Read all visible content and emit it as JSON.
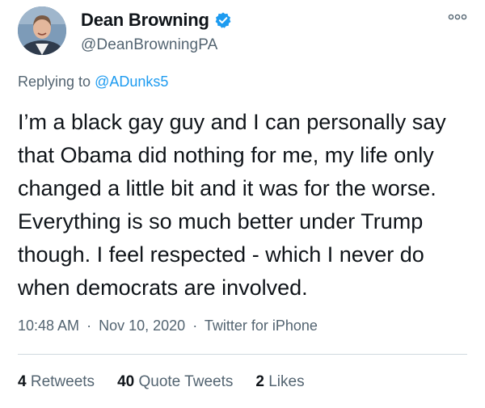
{
  "author": {
    "display_name": "Dean Browning",
    "handle": "@DeanBrowningPA",
    "verified": true
  },
  "more_icon": "more-horizontal-icon",
  "reply": {
    "prefix": "Replying to ",
    "mention": "@ADunks5"
  },
  "tweet": {
    "text": "I’m a black gay guy and I can personally say that Obama did nothing for me, my life only changed a little bit and it was for the worse. Everything is so much better under Trump though. I feel respected - which I never do when democrats are involved."
  },
  "meta": {
    "time": "10:48 AM",
    "separator": "·",
    "date": "Nov 10, 2020",
    "source": "Twitter for iPhone"
  },
  "stats": {
    "retweets_count": "4",
    "retweets_label": "Retweets",
    "quotes_count": "40",
    "quotes_label": "Quote Tweets",
    "likes_count": "2",
    "likes_label": "Likes"
  },
  "colors": {
    "verified_blue": "#1d9bf0",
    "mention_blue": "#1d9bf0",
    "secondary_text": "#536471",
    "primary_text": "#0f1419"
  }
}
